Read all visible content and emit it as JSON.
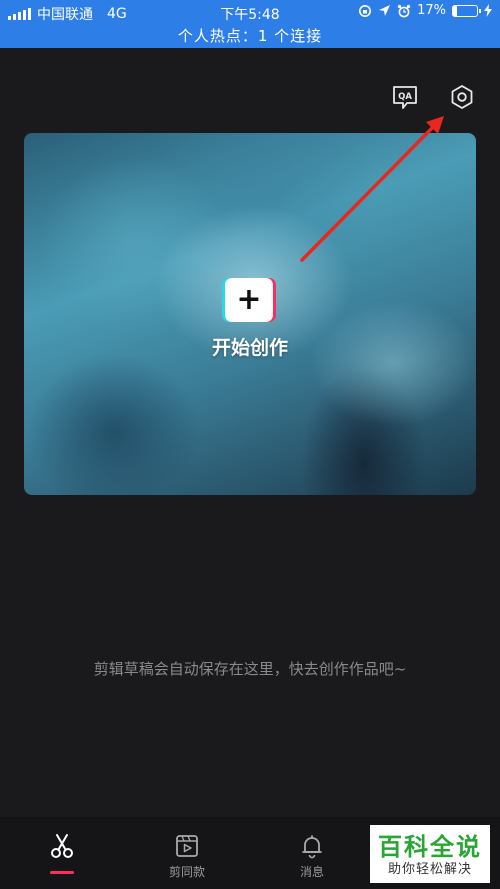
{
  "status_bar": {
    "carrier": "中国联通",
    "network": "4G",
    "time": "下午5:48",
    "battery": "17%",
    "battery_level": 0.17,
    "hotspot": "个人热点：1 个连接"
  },
  "top_actions": {
    "qa_icon": "qa-icon",
    "settings_icon": "settings-icon"
  },
  "hero": {
    "create_symbol": "+",
    "create_label": "开始创作"
  },
  "empty_hint": "剪辑草稿会自动保存在这里，快去创作作品吧~",
  "tabs": [
    {
      "label": "",
      "icon": "scissors-icon",
      "active": true
    },
    {
      "label": "剪同款",
      "icon": "template-icon",
      "active": false
    },
    {
      "label": "消息",
      "icon": "bell-icon",
      "active": false
    }
  ],
  "colors": {
    "status_bar": "#2d7ee6",
    "background": "#1a1a1c",
    "accent": "#ff2f5a",
    "arrow": "#e8281e"
  },
  "watermark": {
    "main": "百科全说",
    "sub": "助你轻松解决"
  }
}
